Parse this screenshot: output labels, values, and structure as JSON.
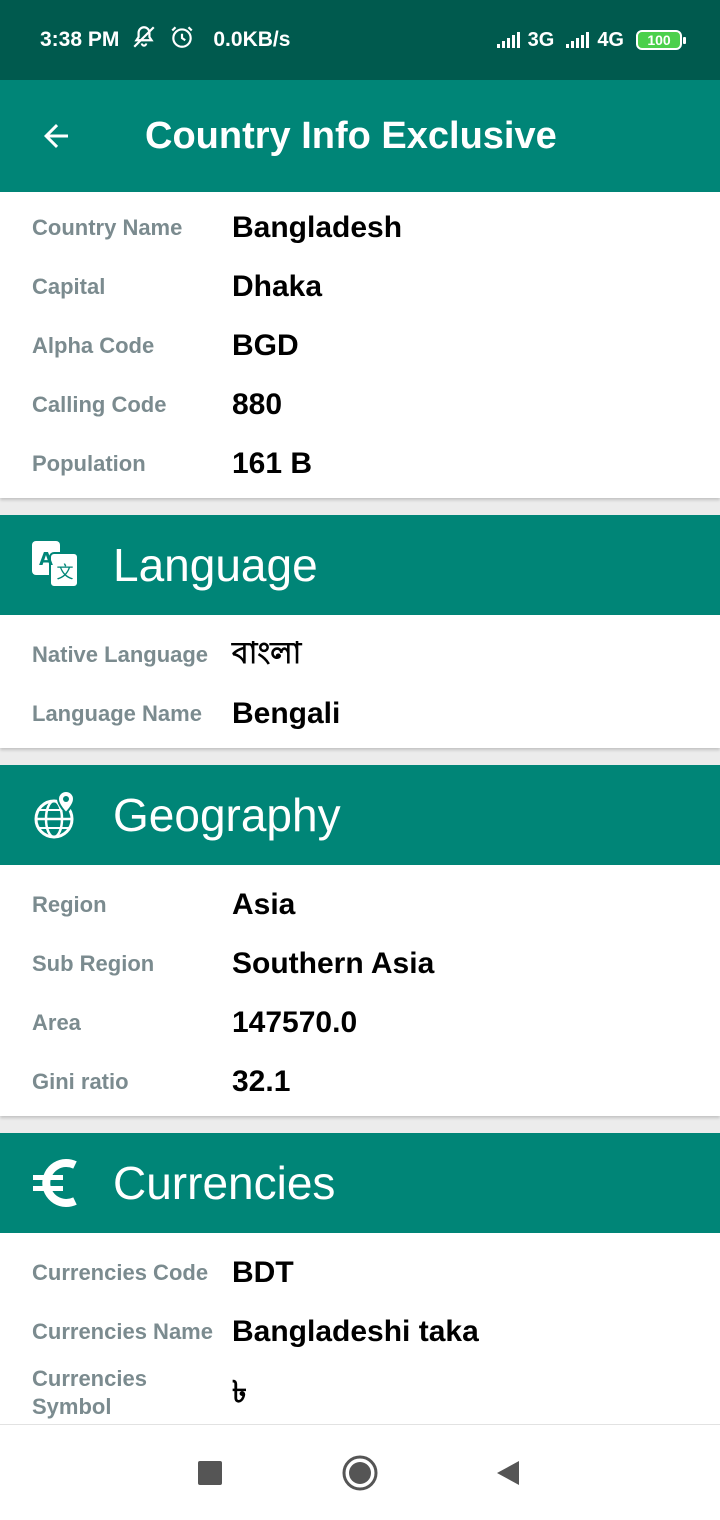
{
  "status_bar": {
    "time": "3:38 PM",
    "speed": "0.0KB/s",
    "net1": "3G",
    "net2": "4G",
    "battery": "100"
  },
  "app_bar": {
    "title": "Country Info Exclusive"
  },
  "general": [
    {
      "label": "Country Name",
      "value": "Bangladesh"
    },
    {
      "label": "Capital",
      "value": "Dhaka"
    },
    {
      "label": "Alpha Code",
      "value": "BGD"
    },
    {
      "label": "Calling Code",
      "value": "880"
    },
    {
      "label": "Population",
      "value": "161 B"
    }
  ],
  "language": {
    "title": "Language",
    "icon": "translate-icon",
    "rows": [
      {
        "label": "Native Language",
        "value": "বাংলা"
      },
      {
        "label": "Language Name",
        "value": "Bengali"
      }
    ]
  },
  "geography": {
    "title": "Geography",
    "icon": "globe-pin-icon",
    "rows": [
      {
        "label": "Region",
        "value": "Asia"
      },
      {
        "label": "Sub Region",
        "value": "Southern Asia"
      },
      {
        "label": "Area",
        "value": "147570.0"
      },
      {
        "label": "Gini ratio",
        "value": "32.1"
      }
    ]
  },
  "currencies": {
    "title": "Currencies",
    "icon": "euro-icon",
    "rows": [
      {
        "label": "Currencies Code",
        "value": "BDT"
      },
      {
        "label": "Currencies Name",
        "value": "Bangladeshi taka"
      },
      {
        "label": "Currencies Symbol",
        "value": "৳"
      }
    ]
  },
  "colors": {
    "primary": "#008577",
    "primary_dark": "#005a4e",
    "label": "#7b8b8f"
  }
}
